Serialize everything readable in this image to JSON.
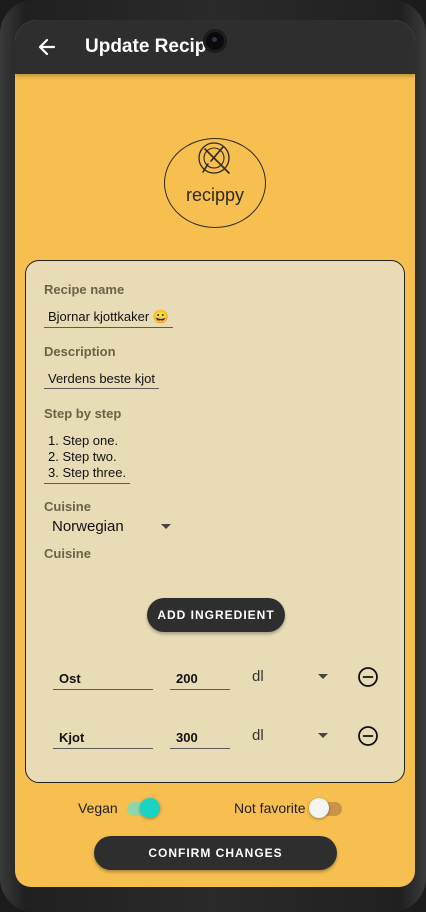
{
  "appbar": {
    "title": "Update Recipe"
  },
  "logo": {
    "text": "recippy"
  },
  "form": {
    "recipe_name_label": "Recipe name",
    "recipe_name_value": "Bjornar kjottkaker 😀",
    "description_label": "Description",
    "description_value": "Verdens beste kjot",
    "steps_label": "Step by step",
    "steps": [
      "1. Step one.",
      "2. Step two.",
      "3. Step three."
    ],
    "cuisine_label": "Cuisine",
    "cuisine_value": "Norwegian",
    "cuisine_helper": "Cuisine",
    "add_ingredient_label": "ADD INGREDIENT"
  },
  "ingredients": [
    {
      "name": "Ost",
      "amount": "200",
      "unit": "dl"
    },
    {
      "name": "Kjot",
      "amount": "300",
      "unit": "dl"
    }
  ],
  "toggles": {
    "vegan": {
      "label": "Vegan",
      "on": true
    },
    "favorite": {
      "label": "Not favorite",
      "on": false
    }
  },
  "confirm_label": "CONFIRM CHANGES",
  "colors": {
    "background": "#f7bf4f",
    "appbar": "#2e2e2e",
    "card": "#e8dcb7",
    "toggle_on": "#1bd3c4",
    "toggle_off_track": "#c9944a"
  }
}
